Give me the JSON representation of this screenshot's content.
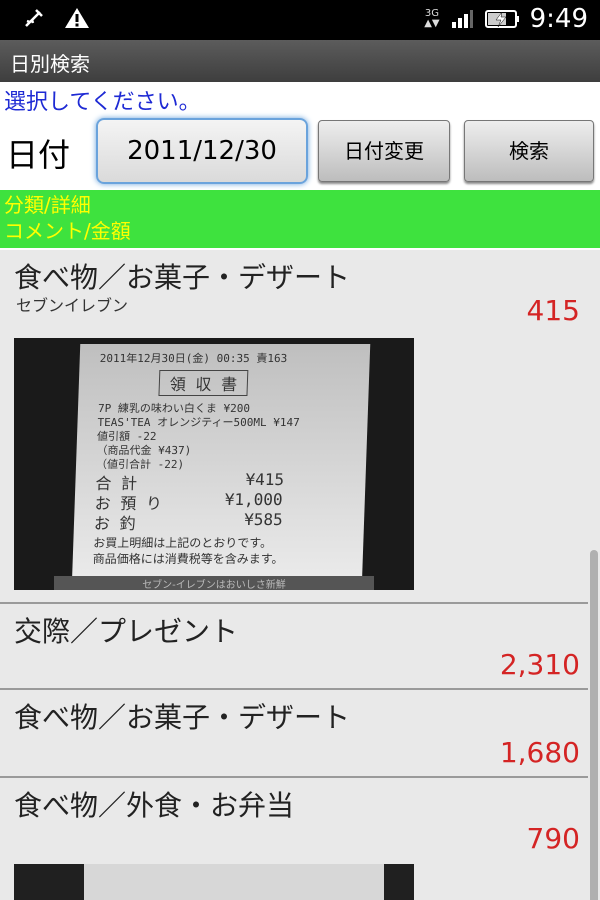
{
  "status": {
    "time": "9:49",
    "network": "3G",
    "icons": [
      "usb-debug-icon",
      "warning-icon",
      "network-3g-icon",
      "signal-icon",
      "battery-charging-icon"
    ]
  },
  "title": "日別検索",
  "prompt": "選択してください。",
  "date": {
    "label": "日付",
    "value": "2011/12/30",
    "change_button": "日付変更",
    "search_button": "検索"
  },
  "header": {
    "line1": "分類/詳細",
    "line2": "コメント/金額"
  },
  "items": [
    {
      "category": "食べ物／お菓子・デザート",
      "comment": "セブンイレブン",
      "amount": "415"
    },
    {
      "category": "交際／プレゼント",
      "comment": "",
      "amount": "2,310"
    },
    {
      "category": "食べ物／お菓子・デザート",
      "comment": "",
      "amount": "1,680"
    },
    {
      "category": "食べ物／外食・お弁当",
      "comment": "",
      "amount": "790"
    }
  ],
  "receipt": {
    "date_line": "2011年12月30日(金) 00:35 責163",
    "heading": "領 収 書",
    "lines": [
      "7P 練乳の味わい白くま    ¥200",
      "TEAS'TEA オレンジティー500ML ¥147",
      "値引額                 -22",
      "（商品代金            ¥437)",
      "（値引合計             -22)"
    ],
    "total_label": "合 計",
    "total": "¥415",
    "paid_label": "お 預 り",
    "paid": "¥1,000",
    "change_label": "お 釣",
    "change": "¥585",
    "note1": "お買上明細は上記のとおりです。",
    "note2": "商品価格には消費税等を含みます。",
    "footer": "セブン-イレブンはおいしさ新鮮"
  },
  "colors": {
    "header_bg": "#3ee23e",
    "header_text": "#ffff00",
    "amount": "#d42424",
    "prompt": "#1e2ad4"
  }
}
